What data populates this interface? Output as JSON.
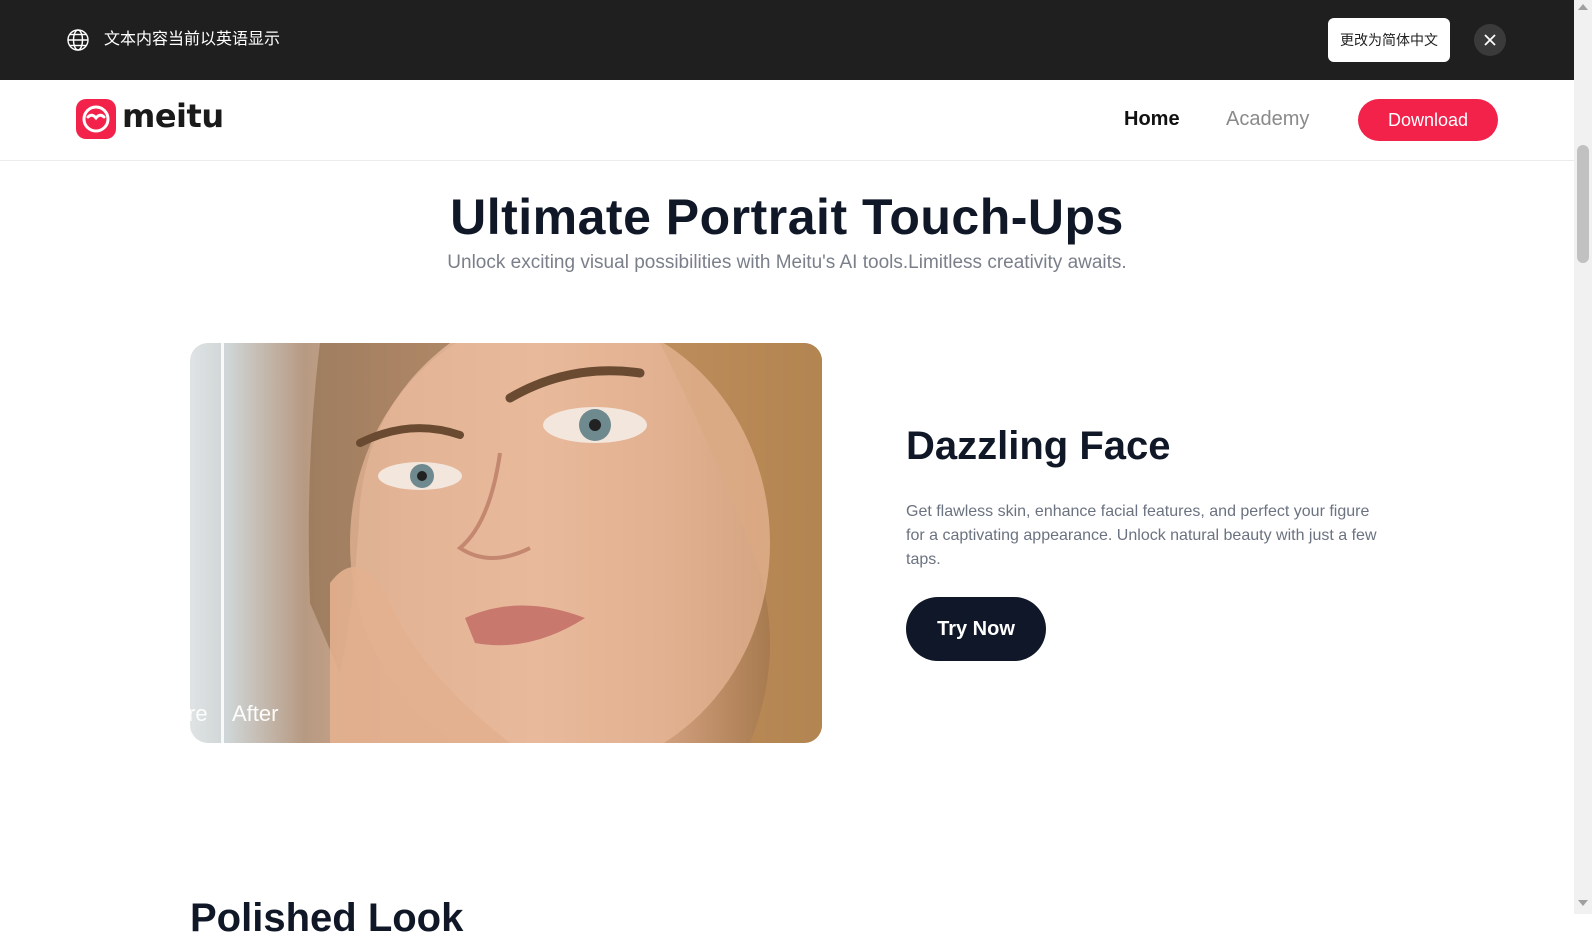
{
  "banner": {
    "message": "文本内容当前以英语显示",
    "switch_label": "更改为简体中文",
    "globe_icon": "globe-icon",
    "close_icon": "close-icon"
  },
  "nav": {
    "logo_text": "meitu",
    "home": "Home",
    "academy": "Academy",
    "download": "Download",
    "accent_color": "#f2224a"
  },
  "hero": {
    "title": "Ultimate Portrait Touch-Ups",
    "subtitle": "Unlock exciting visual possibilities with Meitu's AI tools.Limitless creativity awaits."
  },
  "feature": {
    "before_label": "re",
    "after_label": "After",
    "title": "Dazzling Face",
    "description": "Get flawless skin, enhance facial features, and perfect your figure for a captivating appearance. Unlock natural beauty with just a few taps.",
    "cta": "Try Now"
  },
  "next_section": {
    "heading_partial": "Polished Look"
  }
}
